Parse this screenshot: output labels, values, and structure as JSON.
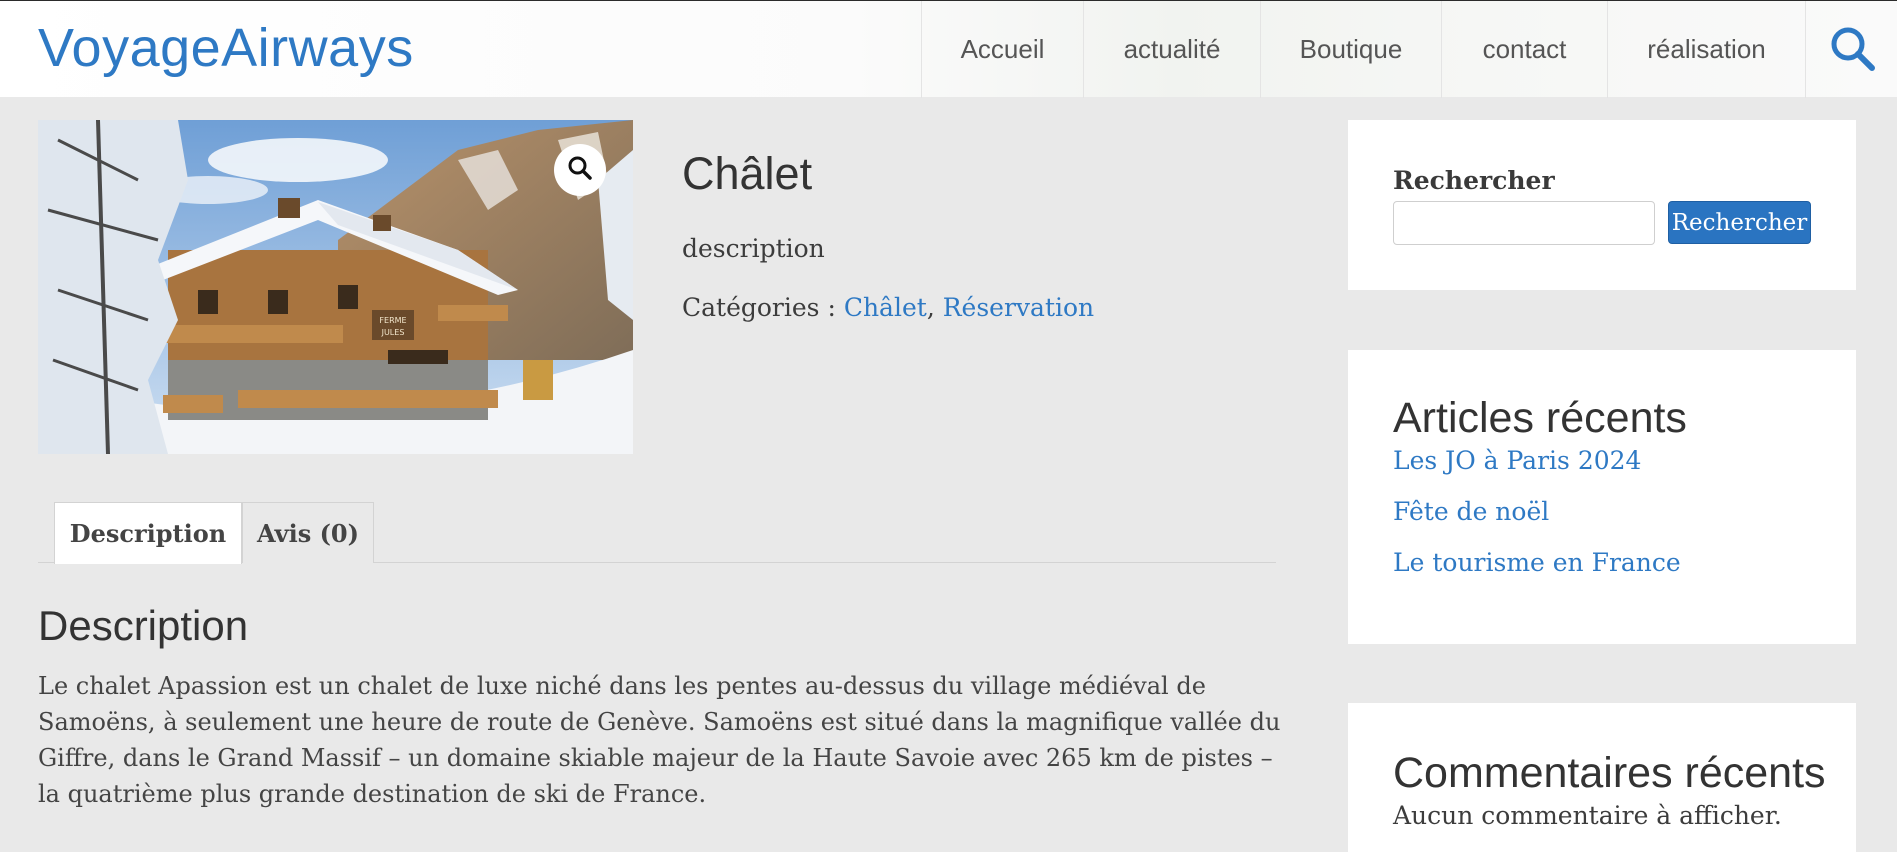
{
  "header": {
    "brand": "VoyageAirways",
    "nav": [
      "Accueil",
      "actualité",
      "Boutique",
      "contact",
      "réalisation"
    ],
    "search_icon": "search-icon"
  },
  "product": {
    "image_alt": "Chalet enneigé",
    "image_sign_line1": "FERME",
    "image_sign_line2": "JULES",
    "zoom_icon": "magnifier-icon",
    "title": "Châlet",
    "short_description": "description",
    "categories_label": "Catégories : ",
    "categories": [
      "Châlet",
      "Réservation"
    ],
    "categories_separator": ", "
  },
  "tabs": [
    {
      "label": "Description",
      "active": true
    },
    {
      "label": "Avis (0)",
      "active": false
    }
  ],
  "description": {
    "heading": "Description",
    "text": "Le chalet Apassion est un chalet de luxe niché dans les pentes au-dessus du village médiéval de Samoëns, à seulement une heure de route de Genève. Samoëns est situé dans la magnifique vallée du Giffre, dans le Grand Massif – un domaine skiable majeur de la Haute Savoie avec 265 km de pistes – la quatrième plus grande destination de ski de France."
  },
  "sidebar": {
    "search": {
      "label": "Rechercher",
      "placeholder": "",
      "button": "Rechercher"
    },
    "recent_posts": {
      "title": "Articles récents",
      "items": [
        "Les JO à Paris 2024",
        "Fête de noël",
        "Le tourisme en France"
      ]
    },
    "recent_comments": {
      "title": "Commentaires récents",
      "empty": "Aucun commentaire à afficher."
    }
  },
  "colors": {
    "accent": "#2e79c4",
    "button": "#2a74c1",
    "background": "#e9e9e9"
  }
}
